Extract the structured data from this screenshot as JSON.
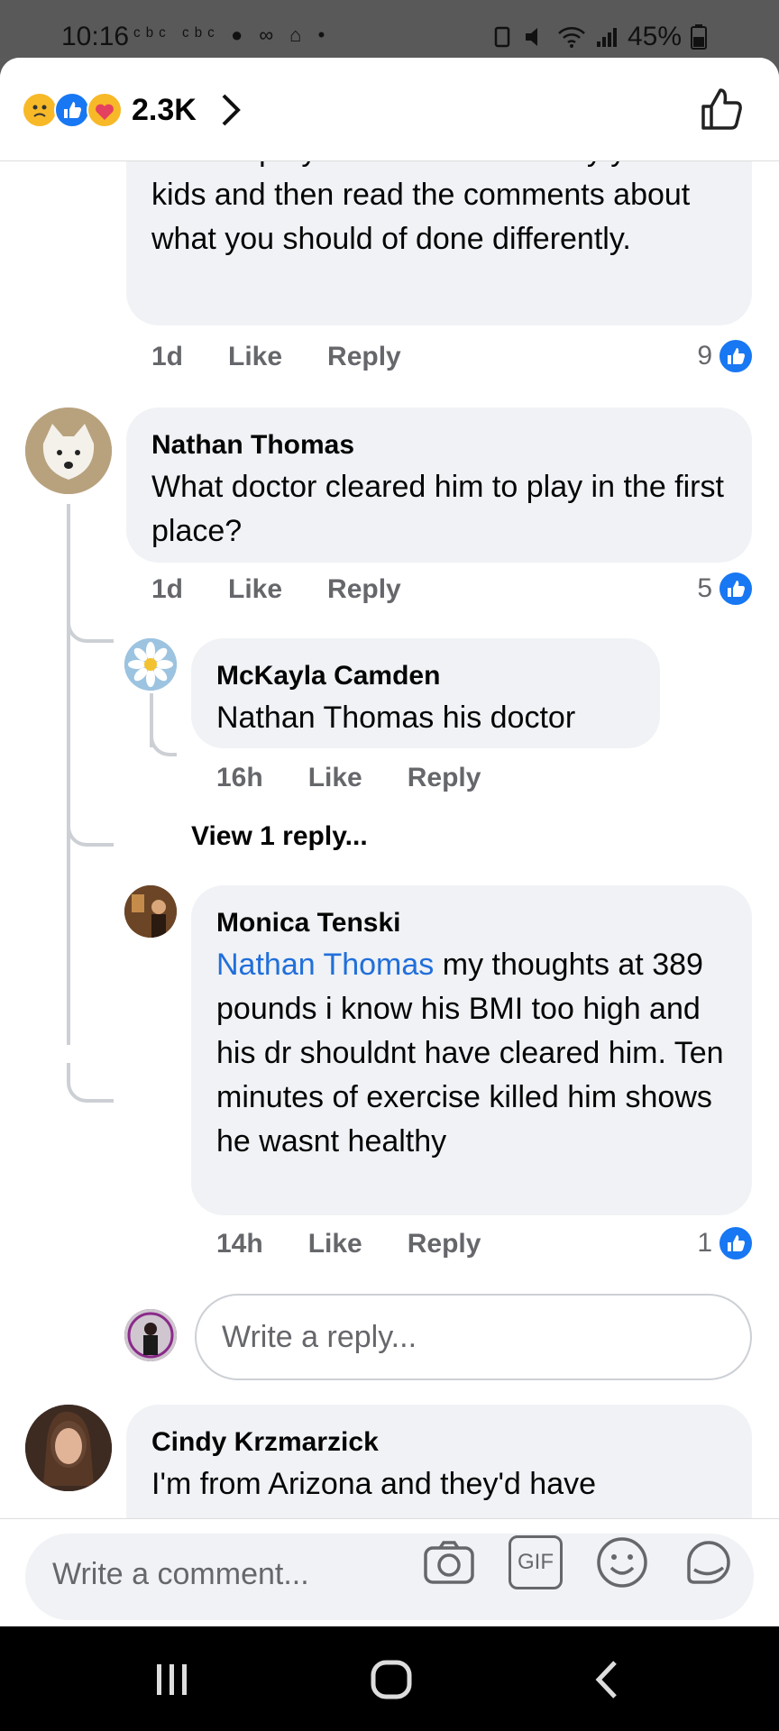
{
  "status_bar": {
    "time": "10:16",
    "battery": "45%",
    "left_icons": "ᶜᵇᶜ ᶜᵇᶜ ● ∞ ⌂ •"
  },
  "reactions_bar": {
    "count": "2.3K"
  },
  "comments": [
    {
      "text_partial_top": "Sure hope you don't have to bury your",
      "text": "kids and then read the comments about what you should of done differently.",
      "time": "1d",
      "like": "Like",
      "reply": "Reply",
      "likes": "9"
    },
    {
      "name": "Nathan Thomas",
      "text": "What doctor cleared him to play in the first place?",
      "time": "1d",
      "like": "Like",
      "reply": "Reply",
      "likes": "5"
    }
  ],
  "replies": [
    {
      "name": "McKayla Camden",
      "text": "Nathan Thomas his doctor",
      "time": "16h",
      "like": "Like",
      "reply": "Reply"
    },
    {
      "name": "Monica Tenski",
      "mention": "Nathan Thomas",
      "text": " my thoughts at 389 pounds i know his BMI too high and his dr shouldnt have cleared him. Ten minutes of exercise killed him shows he wasnt healthy",
      "time": "14h",
      "like": "Like",
      "reply": "Reply",
      "likes": "1"
    }
  ],
  "view_more": "View 1 reply...",
  "reply_placeholder": "Write a reply...",
  "next_comment": {
    "name": "Cindy Krzmarzick",
    "text": "I'm from Arizona and they'd have"
  },
  "composer": {
    "placeholder": "Write a comment...",
    "gif": "GIF"
  },
  "colors": {
    "accent": "#1877f2",
    "bubble": "#f0f2f5",
    "meta": "#65676b"
  }
}
